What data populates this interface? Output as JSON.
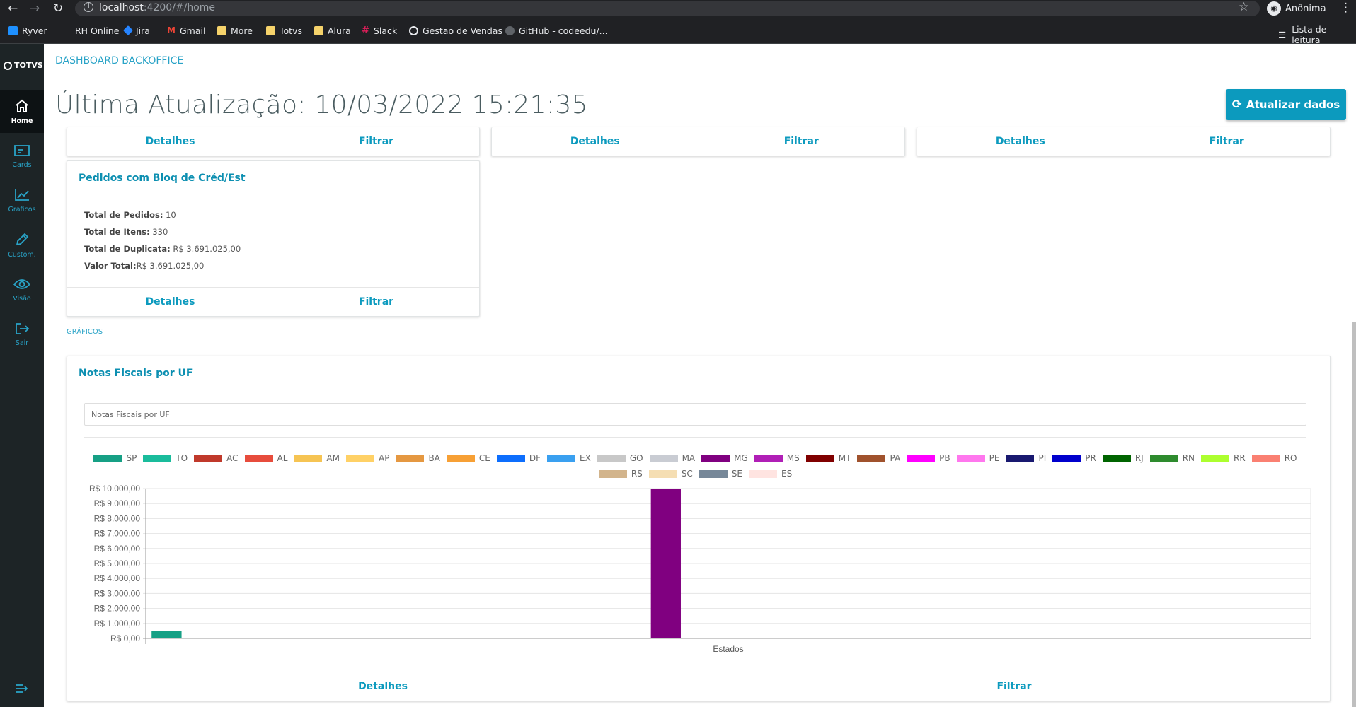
{
  "browser": {
    "url_host": "localhost",
    "url_rest": ":4200/#/home",
    "profile": "Anônima",
    "bookmarks": [
      "Ryver",
      "RH Online",
      "Jira",
      "Gmail",
      "More",
      "Totvs",
      "Alura",
      "Slack",
      "Gestao de Vendas",
      "GitHub - codeedu/..."
    ],
    "reading_list": "Lista de leitura"
  },
  "sidebar": {
    "logo": "TOTVS",
    "items": [
      {
        "label": "Home",
        "icon": "home-icon"
      },
      {
        "label": "Cards",
        "icon": "cards-icon"
      },
      {
        "label": "Gráficos",
        "icon": "chart-icon"
      },
      {
        "label": "Custom.",
        "icon": "pencil-icon"
      },
      {
        "label": "Visão",
        "icon": "eye-icon"
      },
      {
        "label": "Sair",
        "icon": "logout-icon"
      }
    ]
  },
  "header": {
    "breadcrumb": "DASHBOARD BACKOFFICE",
    "title": "Última Atualização: 10/03/2022 15:21:35",
    "refresh_button": "Atualizar dados"
  },
  "actions": {
    "details": "Detalhes",
    "filter": "Filtrar"
  },
  "card_bloq": {
    "title": "Pedidos com Bloq de Créd/Est",
    "rows": [
      {
        "label": "Total de Pedidos:",
        "value": " 10"
      },
      {
        "label": "Total de Itens:",
        "value": " 330"
      },
      {
        "label": "Total de Duplicata:",
        "value": " R$ 3.691.025,00"
      },
      {
        "label": "Valor Total:",
        "value": "R$ 3.691.025,00"
      }
    ]
  },
  "section_graficos": "GRÁFICOS",
  "chart_card": {
    "title": "Notas Fiscais por UF",
    "box_title": "Notas Fiscais por UF"
  },
  "chart_data": {
    "type": "bar",
    "title": "Notas Fiscais por UF",
    "xlabel": "Estados",
    "ylabel": "",
    "categories": [
      "Estados"
    ],
    "ylim": [
      0,
      10000
    ],
    "yticks": [
      "R$ 10.000,00",
      "R$ 9.000,00",
      "R$ 8.000,00",
      "R$ 7.000,00",
      "R$ 6.000,00",
      "R$ 5.000,00",
      "R$ 4.000,00",
      "R$ 3.000,00",
      "R$ 2.000,00",
      "R$ 1.000,00",
      "R$ 0,00"
    ],
    "grid": true,
    "legend_position": "top",
    "series": [
      {
        "name": "SP",
        "color": "#16a085",
        "value": 500
      },
      {
        "name": "TO",
        "color": "#1abc9c",
        "value": 0
      },
      {
        "name": "AC",
        "color": "#c0392b",
        "value": 0
      },
      {
        "name": "AL",
        "color": "#e74c3c",
        "value": 0
      },
      {
        "name": "AM",
        "color": "#f6c453",
        "value": 0
      },
      {
        "name": "AP",
        "color": "#ffd166",
        "value": 0
      },
      {
        "name": "BA",
        "color": "#e59841",
        "value": 0
      },
      {
        "name": "CE",
        "color": "#f7a035",
        "value": 0
      },
      {
        "name": "DF",
        "color": "#0d6efd",
        "value": 0
      },
      {
        "name": "EX",
        "color": "#3aa0f0",
        "value": 0
      },
      {
        "name": "GO",
        "color": "#c8c8c8",
        "value": 0
      },
      {
        "name": "MA",
        "color": "#c9ccd3",
        "value": 0
      },
      {
        "name": "MG",
        "color": "#800080",
        "value": 10000
      },
      {
        "name": "MS",
        "color": "#b01fb6",
        "value": 0
      },
      {
        "name": "MT",
        "color": "#800000",
        "value": 0
      },
      {
        "name": "PA",
        "color": "#a0522d",
        "value": 0
      },
      {
        "name": "PB",
        "color": "#ff00ff",
        "value": 0
      },
      {
        "name": "PE",
        "color": "#ff77ee",
        "value": 0
      },
      {
        "name": "PI",
        "color": "#191970",
        "value": 0
      },
      {
        "name": "PR",
        "color": "#0000cd",
        "value": 0
      },
      {
        "name": "RJ",
        "color": "#006400",
        "value": 0
      },
      {
        "name": "RN",
        "color": "#2e8b2e",
        "value": 0
      },
      {
        "name": "RR",
        "color": "#adff2f",
        "value": 0
      },
      {
        "name": "RO",
        "color": "#fa8072",
        "value": 0
      },
      {
        "name": "RS",
        "color": "#d2b48c",
        "value": 0
      },
      {
        "name": "SC",
        "color": "#f5deb3",
        "value": 0
      },
      {
        "name": "SE",
        "color": "#778899",
        "value": 0
      },
      {
        "name": "ES",
        "color": "#ffe4e1",
        "value": 0
      }
    ]
  }
}
